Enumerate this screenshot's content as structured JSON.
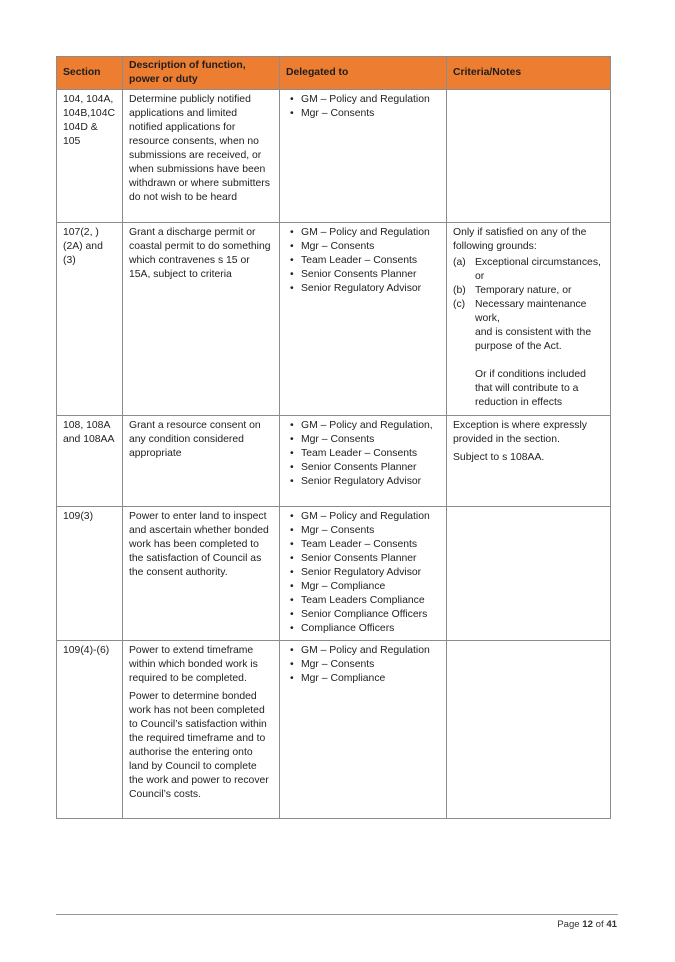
{
  "table": {
    "headers": {
      "section": "Section",
      "description": "Description of function, power or duty",
      "delegated_to": "Delegated to",
      "criteria": "Criteria/Notes"
    },
    "rows": [
      {
        "section": "104, 104A, 104B,104C 104D & 105",
        "description": [
          "Determine publicly notified applications and limited notified applications for resource consents, when no submissions are received, or when submissions have been withdrawn or where submitters do not wish to be heard"
        ],
        "delegated_to": [
          "GM – Policy and Regulation",
          "Mgr – Consents"
        ],
        "criteria": null
      },
      {
        "section": "107(2, )(2A) and (3)",
        "description": [
          "Grant a discharge permit or coastal permit to do something which contravenes s 15 or 15A, subject to criteria"
        ],
        "delegated_to": [
          "GM – Policy and Regulation",
          "Mgr – Consents",
          "Team Leader – Consents",
          "Senior Consents Planner",
          "Senior Regulatory Advisor"
        ],
        "criteria": {
          "intro": "Only if satisfied on any of the following grounds:",
          "items": [
            {
              "label": "(a)",
              "text": "Exceptional circumstances, or"
            },
            {
              "label": "(b)",
              "text": "Temporary nature, or"
            },
            {
              "label": "(c)",
              "text": "Necessary maintenance work,"
            }
          ],
          "consistent": "and is consistent with the purpose of the Act.",
          "alternative": "Or if conditions included that will contribute to a reduction in effects"
        }
      },
      {
        "section": "108, 108A and 108AA",
        "description": [
          "Grant a resource consent on any condition considered appropriate"
        ],
        "delegated_to": [
          "GM – Policy and Regulation,",
          "Mgr – Consents",
          "Team Leader – Consents",
          "Senior Consents Planner",
          "Senior Regulatory Advisor"
        ],
        "criteria": {
          "paragraphs": [
            "Exception is where expressly provided in the section.",
            "Subject to s 108AA."
          ]
        }
      },
      {
        "section": "109(3)",
        "description": [
          "Power to enter land to inspect and ascertain whether bonded work has been completed to the satisfaction of Council as the consent authority."
        ],
        "delegated_to": [
          "GM – Policy and Regulation",
          "Mgr – Consents",
          "Team Leader – Consents",
          "Senior Consents Planner",
          "Senior Regulatory Advisor",
          "Mgr – Compliance",
          "Team Leaders Compliance",
          "Senior Compliance Officers",
          "Compliance Officers"
        ],
        "criteria": null
      },
      {
        "section": "109(4)-(6)",
        "description": [
          "Power to extend timeframe within which bonded work is required to be completed.",
          "Power to determine bonded work has not been completed to Council’s satisfaction within the required timeframe and to authorise the entering onto land by Council to complete the work and power to recover Council’s costs."
        ],
        "delegated_to": [
          "GM – Policy and Regulation",
          "Mgr – Consents",
          "Mgr – Compliance"
        ],
        "criteria": null
      }
    ]
  },
  "footer": {
    "page_label": "Page",
    "page_number": "12",
    "of_label": "of",
    "total_pages": "41"
  },
  "colors": {
    "header_bg": "#ed7d31",
    "border": "#8c8c8c"
  }
}
